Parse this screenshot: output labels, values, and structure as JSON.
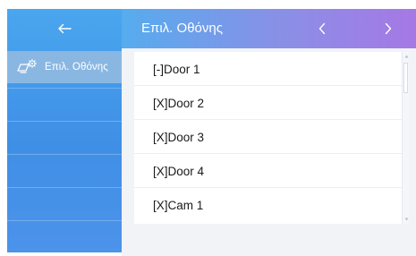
{
  "header": {
    "back_icon": "arrow-left-icon",
    "title": "Επιλ. Οθόνης",
    "prev_icon": "chevron-left-icon",
    "next_icon": "chevron-right-icon"
  },
  "sidebar": {
    "items": [
      {
        "label": "Επιλ. Οθόνης",
        "icon": "screen-settings-icon",
        "selected": true
      }
    ]
  },
  "list": {
    "items": [
      {
        "label": "[-]Door 1"
      },
      {
        "label": "[X]Door 2"
      },
      {
        "label": "[X]Door 3"
      },
      {
        "label": "[X]Door 4"
      },
      {
        "label": "[X]Cam 1"
      }
    ]
  },
  "colors": {
    "sidebar": "#4a9de9",
    "sidebar_selected": "#8ab7e2",
    "header_start": "#56acee",
    "header_end": "#a678e5",
    "content_bg": "#f1f3f7"
  }
}
